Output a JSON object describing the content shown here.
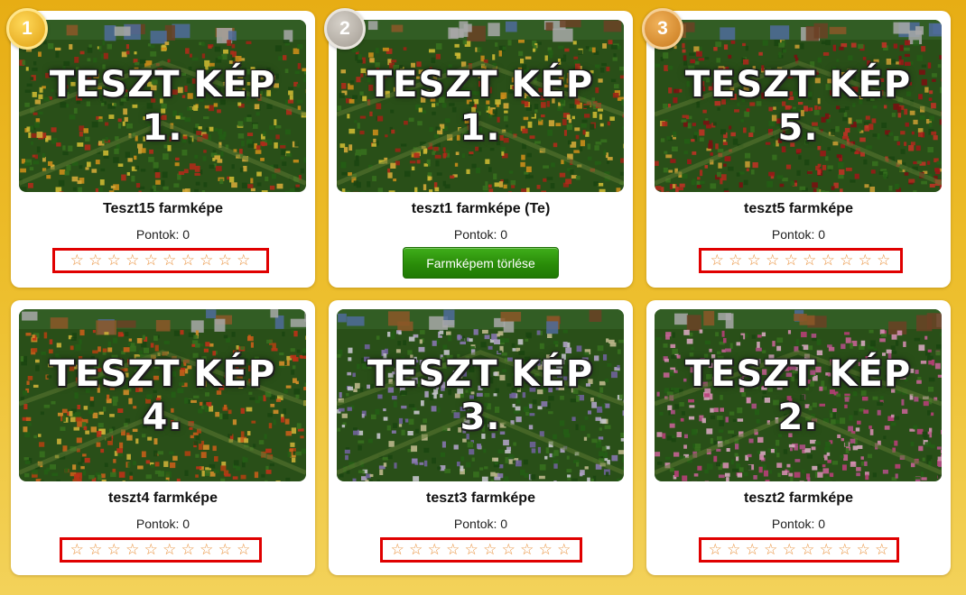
{
  "cards": [
    {
      "rank": "1",
      "caption_line1": "TESZT KÉP",
      "caption_line2": "1.",
      "title": "Teszt15 farmképe",
      "you_tag": "",
      "points": "Pontok: 0",
      "stars": [
        "☆",
        "☆",
        "☆",
        "☆",
        "☆",
        "☆",
        "☆",
        "☆",
        "☆",
        "☆"
      ],
      "palette": "red"
    },
    {
      "rank": "2",
      "caption_line1": "TESZT KÉP",
      "caption_line2": "1.",
      "title": "teszt1 farmképe",
      "you_tag": "(Te)",
      "points": "Pontok: 0",
      "delete_button": "Farmképem törlése",
      "palette": "red"
    },
    {
      "rank": "3",
      "caption_line1": "TESZT KÉP",
      "caption_line2": "5.",
      "title": "teszt5 farmképe",
      "you_tag": "",
      "points": "Pontok: 0",
      "stars": [
        "☆",
        "☆",
        "☆",
        "☆",
        "☆",
        "☆",
        "☆",
        "☆",
        "☆",
        "☆"
      ],
      "palette": "crimson"
    },
    {
      "rank": "",
      "caption_line1": "TESZT KÉP",
      "caption_line2": "4.",
      "title": "teszt4 farmképe",
      "you_tag": "",
      "points": "Pontok: 0",
      "stars": [
        "☆",
        "☆",
        "☆",
        "☆",
        "☆",
        "☆",
        "☆",
        "☆",
        "☆",
        "☆"
      ],
      "palette": "orange"
    },
    {
      "rank": "",
      "caption_line1": "TESZT KÉP",
      "caption_line2": "3.",
      "title": "teszt3 farmképe",
      "you_tag": "",
      "points": "Pontok: 0",
      "stars": [
        "☆",
        "☆",
        "☆",
        "☆",
        "☆",
        "☆",
        "☆",
        "☆",
        "☆",
        "☆"
      ],
      "palette": "lavender"
    },
    {
      "rank": "",
      "caption_line1": "TESZT KÉP",
      "caption_line2": "2.",
      "title": "teszt2 farmképe",
      "you_tag": "",
      "points": "Pontok: 0",
      "stars": [
        "☆",
        "☆",
        "☆",
        "☆",
        "☆",
        "☆",
        "☆",
        "☆",
        "☆",
        "☆"
      ],
      "palette": "pink"
    }
  ],
  "colors": {
    "background": "#e7ad14",
    "star": "#e9903b",
    "highlight_border": "#e00000",
    "delete_button": "#2a8c09",
    "gold": "#e0a013",
    "silver": "#a39c93",
    "bronze": "#c97a1e"
  }
}
